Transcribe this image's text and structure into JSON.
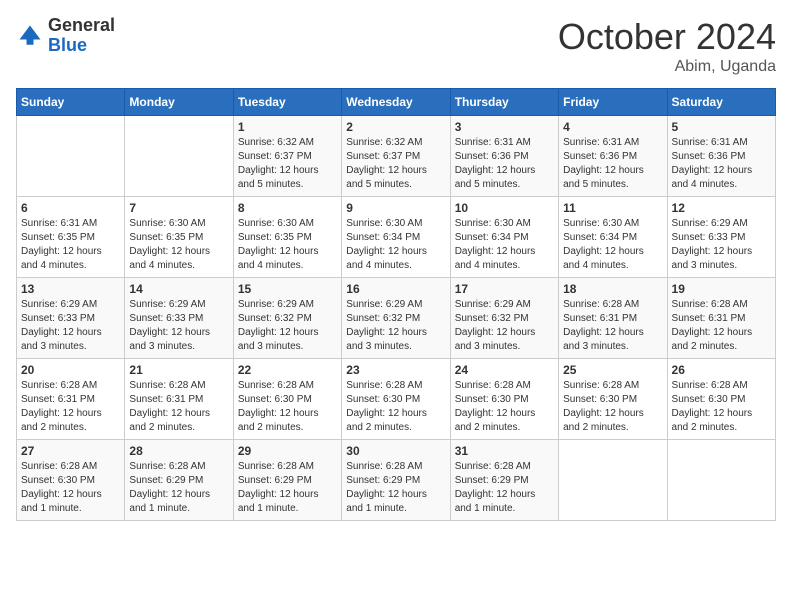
{
  "logo": {
    "general": "General",
    "blue": "Blue"
  },
  "title": "October 2024",
  "subtitle": "Abim, Uganda",
  "days_of_week": [
    "Sunday",
    "Monday",
    "Tuesday",
    "Wednesday",
    "Thursday",
    "Friday",
    "Saturday"
  ],
  "weeks": [
    [
      {
        "day": "",
        "info": ""
      },
      {
        "day": "",
        "info": ""
      },
      {
        "day": "1",
        "info": "Sunrise: 6:32 AM\nSunset: 6:37 PM\nDaylight: 12 hours\nand 5 minutes."
      },
      {
        "day": "2",
        "info": "Sunrise: 6:32 AM\nSunset: 6:37 PM\nDaylight: 12 hours\nand 5 minutes."
      },
      {
        "day": "3",
        "info": "Sunrise: 6:31 AM\nSunset: 6:36 PM\nDaylight: 12 hours\nand 5 minutes."
      },
      {
        "day": "4",
        "info": "Sunrise: 6:31 AM\nSunset: 6:36 PM\nDaylight: 12 hours\nand 5 minutes."
      },
      {
        "day": "5",
        "info": "Sunrise: 6:31 AM\nSunset: 6:36 PM\nDaylight: 12 hours\nand 4 minutes."
      }
    ],
    [
      {
        "day": "6",
        "info": "Sunrise: 6:31 AM\nSunset: 6:35 PM\nDaylight: 12 hours\nand 4 minutes."
      },
      {
        "day": "7",
        "info": "Sunrise: 6:30 AM\nSunset: 6:35 PM\nDaylight: 12 hours\nand 4 minutes."
      },
      {
        "day": "8",
        "info": "Sunrise: 6:30 AM\nSunset: 6:35 PM\nDaylight: 12 hours\nand 4 minutes."
      },
      {
        "day": "9",
        "info": "Sunrise: 6:30 AM\nSunset: 6:34 PM\nDaylight: 12 hours\nand 4 minutes."
      },
      {
        "day": "10",
        "info": "Sunrise: 6:30 AM\nSunset: 6:34 PM\nDaylight: 12 hours\nand 4 minutes."
      },
      {
        "day": "11",
        "info": "Sunrise: 6:30 AM\nSunset: 6:34 PM\nDaylight: 12 hours\nand 4 minutes."
      },
      {
        "day": "12",
        "info": "Sunrise: 6:29 AM\nSunset: 6:33 PM\nDaylight: 12 hours\nand 3 minutes."
      }
    ],
    [
      {
        "day": "13",
        "info": "Sunrise: 6:29 AM\nSunset: 6:33 PM\nDaylight: 12 hours\nand 3 minutes."
      },
      {
        "day": "14",
        "info": "Sunrise: 6:29 AM\nSunset: 6:33 PM\nDaylight: 12 hours\nand 3 minutes."
      },
      {
        "day": "15",
        "info": "Sunrise: 6:29 AM\nSunset: 6:32 PM\nDaylight: 12 hours\nand 3 minutes."
      },
      {
        "day": "16",
        "info": "Sunrise: 6:29 AM\nSunset: 6:32 PM\nDaylight: 12 hours\nand 3 minutes."
      },
      {
        "day": "17",
        "info": "Sunrise: 6:29 AM\nSunset: 6:32 PM\nDaylight: 12 hours\nand 3 minutes."
      },
      {
        "day": "18",
        "info": "Sunrise: 6:28 AM\nSunset: 6:31 PM\nDaylight: 12 hours\nand 3 minutes."
      },
      {
        "day": "19",
        "info": "Sunrise: 6:28 AM\nSunset: 6:31 PM\nDaylight: 12 hours\nand 2 minutes."
      }
    ],
    [
      {
        "day": "20",
        "info": "Sunrise: 6:28 AM\nSunset: 6:31 PM\nDaylight: 12 hours\nand 2 minutes."
      },
      {
        "day": "21",
        "info": "Sunrise: 6:28 AM\nSunset: 6:31 PM\nDaylight: 12 hours\nand 2 minutes."
      },
      {
        "day": "22",
        "info": "Sunrise: 6:28 AM\nSunset: 6:30 PM\nDaylight: 12 hours\nand 2 minutes."
      },
      {
        "day": "23",
        "info": "Sunrise: 6:28 AM\nSunset: 6:30 PM\nDaylight: 12 hours\nand 2 minutes."
      },
      {
        "day": "24",
        "info": "Sunrise: 6:28 AM\nSunset: 6:30 PM\nDaylight: 12 hours\nand 2 minutes."
      },
      {
        "day": "25",
        "info": "Sunrise: 6:28 AM\nSunset: 6:30 PM\nDaylight: 12 hours\nand 2 minutes."
      },
      {
        "day": "26",
        "info": "Sunrise: 6:28 AM\nSunset: 6:30 PM\nDaylight: 12 hours\nand 2 minutes."
      }
    ],
    [
      {
        "day": "27",
        "info": "Sunrise: 6:28 AM\nSunset: 6:30 PM\nDaylight: 12 hours\nand 1 minute."
      },
      {
        "day": "28",
        "info": "Sunrise: 6:28 AM\nSunset: 6:29 PM\nDaylight: 12 hours\nand 1 minute."
      },
      {
        "day": "29",
        "info": "Sunrise: 6:28 AM\nSunset: 6:29 PM\nDaylight: 12 hours\nand 1 minute."
      },
      {
        "day": "30",
        "info": "Sunrise: 6:28 AM\nSunset: 6:29 PM\nDaylight: 12 hours\nand 1 minute."
      },
      {
        "day": "31",
        "info": "Sunrise: 6:28 AM\nSunset: 6:29 PM\nDaylight: 12 hours\nand 1 minute."
      },
      {
        "day": "",
        "info": ""
      },
      {
        "day": "",
        "info": ""
      }
    ]
  ]
}
